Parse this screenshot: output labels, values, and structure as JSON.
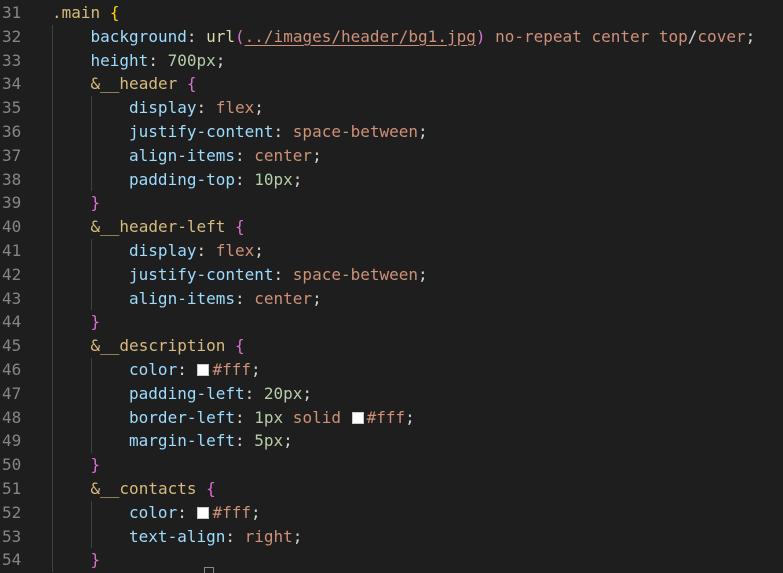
{
  "editor": {
    "language": "scss",
    "theme_colors": {
      "background": "#1e1e1e",
      "line_number": "#858585",
      "selector": "#d7ba7d",
      "property": "#9cdcfe",
      "value": "#ce9178",
      "number": "#b5cea8",
      "function": "#dcdcaa",
      "bracket_level1": "#ffd700",
      "bracket_level2": "#da70d6",
      "bracket_level3": "#179fff"
    },
    "lines": [
      {
        "num": "31",
        "indent": 0,
        "tokens": [
          {
            "t": ".main",
            "c": "sel"
          },
          {
            "t": " ",
            "c": "punct"
          },
          {
            "t": "{",
            "c": "b1"
          }
        ]
      },
      {
        "num": "32",
        "indent": 1,
        "tokens": [
          {
            "t": "background",
            "c": "prop"
          },
          {
            "t": ": ",
            "c": "punct"
          },
          {
            "t": "url",
            "c": "fn"
          },
          {
            "t": "(",
            "c": "b2"
          },
          {
            "t": "../images/header/bg1.jpg",
            "c": "url"
          },
          {
            "t": ")",
            "c": "b2"
          },
          {
            "t": " no-repeat center top",
            "c": "val"
          },
          {
            "t": "/",
            "c": "punct"
          },
          {
            "t": "cover",
            "c": "val"
          },
          {
            "t": ";",
            "c": "punct"
          }
        ]
      },
      {
        "num": "33",
        "indent": 1,
        "tokens": [
          {
            "t": "height",
            "c": "prop"
          },
          {
            "t": ": ",
            "c": "punct"
          },
          {
            "t": "700px",
            "c": "num"
          },
          {
            "t": ";",
            "c": "punct"
          }
        ]
      },
      {
        "num": "34",
        "indent": 1,
        "tokens": [
          {
            "t": "&",
            "c": "amp"
          },
          {
            "t": "__header",
            "c": "sel"
          },
          {
            "t": " ",
            "c": "punct"
          },
          {
            "t": "{",
            "c": "b2"
          }
        ]
      },
      {
        "num": "35",
        "indent": 2,
        "tokens": [
          {
            "t": "display",
            "c": "prop"
          },
          {
            "t": ": ",
            "c": "punct"
          },
          {
            "t": "flex",
            "c": "val"
          },
          {
            "t": ";",
            "c": "punct"
          }
        ]
      },
      {
        "num": "36",
        "indent": 2,
        "tokens": [
          {
            "t": "justify-content",
            "c": "prop"
          },
          {
            "t": ": ",
            "c": "punct"
          },
          {
            "t": "space-between",
            "c": "val"
          },
          {
            "t": ";",
            "c": "punct"
          }
        ]
      },
      {
        "num": "37",
        "indent": 2,
        "tokens": [
          {
            "t": "align-items",
            "c": "prop"
          },
          {
            "t": ": ",
            "c": "punct"
          },
          {
            "t": "center",
            "c": "val"
          },
          {
            "t": ";",
            "c": "punct"
          }
        ]
      },
      {
        "num": "38",
        "indent": 2,
        "tokens": [
          {
            "t": "padding-top",
            "c": "prop"
          },
          {
            "t": ": ",
            "c": "punct"
          },
          {
            "t": "10px",
            "c": "num"
          },
          {
            "t": ";",
            "c": "punct"
          }
        ]
      },
      {
        "num": "39",
        "indent": 1,
        "tokens": [
          {
            "t": "}",
            "c": "b2"
          }
        ]
      },
      {
        "num": "40",
        "indent": 1,
        "tokens": [
          {
            "t": "&",
            "c": "amp"
          },
          {
            "t": "__header-left",
            "c": "sel"
          },
          {
            "t": " ",
            "c": "punct"
          },
          {
            "t": "{",
            "c": "b2"
          }
        ]
      },
      {
        "num": "41",
        "indent": 2,
        "tokens": [
          {
            "t": "display",
            "c": "prop"
          },
          {
            "t": ": ",
            "c": "punct"
          },
          {
            "t": "flex",
            "c": "val"
          },
          {
            "t": ";",
            "c": "punct"
          }
        ]
      },
      {
        "num": "42",
        "indent": 2,
        "tokens": [
          {
            "t": "justify-content",
            "c": "prop"
          },
          {
            "t": ": ",
            "c": "punct"
          },
          {
            "t": "space-between",
            "c": "val"
          },
          {
            "t": ";",
            "c": "punct"
          }
        ]
      },
      {
        "num": "43",
        "indent": 2,
        "tokens": [
          {
            "t": "align-items",
            "c": "prop"
          },
          {
            "t": ": ",
            "c": "punct"
          },
          {
            "t": "center",
            "c": "val"
          },
          {
            "t": ";",
            "c": "punct"
          }
        ]
      },
      {
        "num": "44",
        "indent": 1,
        "tokens": [
          {
            "t": "}",
            "c": "b2"
          }
        ]
      },
      {
        "num": "45",
        "indent": 1,
        "tokens": [
          {
            "t": "&",
            "c": "amp"
          },
          {
            "t": "__description",
            "c": "sel"
          },
          {
            "t": " ",
            "c": "punct"
          },
          {
            "t": "{",
            "c": "b2"
          }
        ]
      },
      {
        "num": "46",
        "indent": 2,
        "tokens": [
          {
            "t": "color",
            "c": "prop"
          },
          {
            "t": ": ",
            "c": "punct"
          },
          {
            "t": "",
            "c": "swatch",
            "color": "#ffffff"
          },
          {
            "t": "#fff",
            "c": "val"
          },
          {
            "t": ";",
            "c": "punct"
          }
        ]
      },
      {
        "num": "47",
        "indent": 2,
        "tokens": [
          {
            "t": "padding-left",
            "c": "prop"
          },
          {
            "t": ": ",
            "c": "punct"
          },
          {
            "t": "20px",
            "c": "num"
          },
          {
            "t": ";",
            "c": "punct"
          }
        ]
      },
      {
        "num": "48",
        "indent": 2,
        "tokens": [
          {
            "t": "border-left",
            "c": "prop"
          },
          {
            "t": ": ",
            "c": "punct"
          },
          {
            "t": "1px",
            "c": "num"
          },
          {
            "t": " solid ",
            "c": "val"
          },
          {
            "t": "",
            "c": "swatch",
            "color": "#ffffff"
          },
          {
            "t": "#fff",
            "c": "val"
          },
          {
            "t": ";",
            "c": "punct"
          }
        ]
      },
      {
        "num": "49",
        "indent": 2,
        "tokens": [
          {
            "t": "margin-left",
            "c": "prop"
          },
          {
            "t": ": ",
            "c": "punct"
          },
          {
            "t": "5px",
            "c": "num"
          },
          {
            "t": ";",
            "c": "punct"
          }
        ]
      },
      {
        "num": "50",
        "indent": 1,
        "tokens": [
          {
            "t": "}",
            "c": "b2"
          }
        ]
      },
      {
        "num": "51",
        "indent": 1,
        "tokens": [
          {
            "t": "&",
            "c": "amp"
          },
          {
            "t": "__contacts",
            "c": "sel"
          },
          {
            "t": " ",
            "c": "punct"
          },
          {
            "t": "{",
            "c": "b2"
          }
        ]
      },
      {
        "num": "52",
        "indent": 2,
        "tokens": [
          {
            "t": "color",
            "c": "prop"
          },
          {
            "t": ": ",
            "c": "punct"
          },
          {
            "t": "",
            "c": "swatch",
            "color": "#ffffff"
          },
          {
            "t": "#fff",
            "c": "val"
          },
          {
            "t": ";",
            "c": "punct"
          }
        ]
      },
      {
        "num": "53",
        "indent": 2,
        "tokens": [
          {
            "t": "text-align",
            "c": "prop"
          },
          {
            "t": ": ",
            "c": "punct"
          },
          {
            "t": "right",
            "c": "val"
          },
          {
            "t": ";",
            "c": "punct"
          }
        ]
      },
      {
        "num": "54",
        "indent": 1,
        "tokens": [
          {
            "t": "}",
            "c": "b2"
          }
        ]
      }
    ]
  }
}
